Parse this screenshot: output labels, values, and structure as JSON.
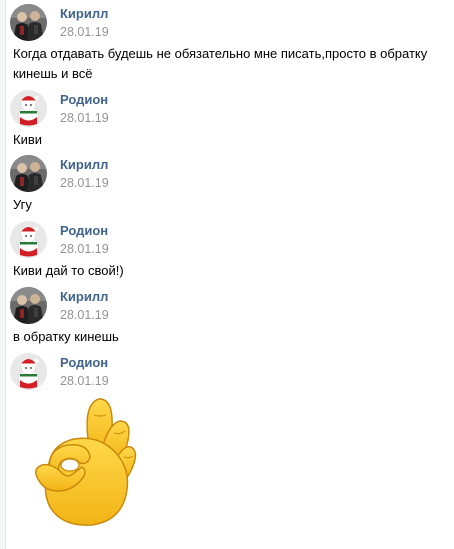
{
  "messages": [
    {
      "author": "Кирилл",
      "date": "28.01.19",
      "avatar_icon": "kirill-avatar-icon",
      "text": "Когда отдавать будешь не обязательно мне писать,просто в обратку кинешь и всё"
    },
    {
      "author": "Родион",
      "date": "28.01.19",
      "avatar_icon": "rodion-avatar-icon",
      "text": "Киви"
    },
    {
      "author": "Кирилл",
      "date": "28.01.19",
      "avatar_icon": "kirill-avatar-icon",
      "text": "Угу"
    },
    {
      "author": "Родион",
      "date": "28.01.19",
      "avatar_icon": "rodion-avatar-icon",
      "text": "Киви дай то свой!)"
    },
    {
      "author": "Кирилл",
      "date": "28.01.19",
      "avatar_icon": "kirill-avatar-icon",
      "text": "в обратку кинешь"
    },
    {
      "author": "Родион",
      "date": "28.01.19",
      "avatar_icon": "rodion-avatar-icon",
      "sticker": "ok-hand-emoji-icon"
    }
  ],
  "colors": {
    "author_name": "#42648b",
    "date": "#939393",
    "text": "#000000",
    "emoji_fill": "#f7c02a",
    "emoji_outline": "#c98a0c"
  }
}
